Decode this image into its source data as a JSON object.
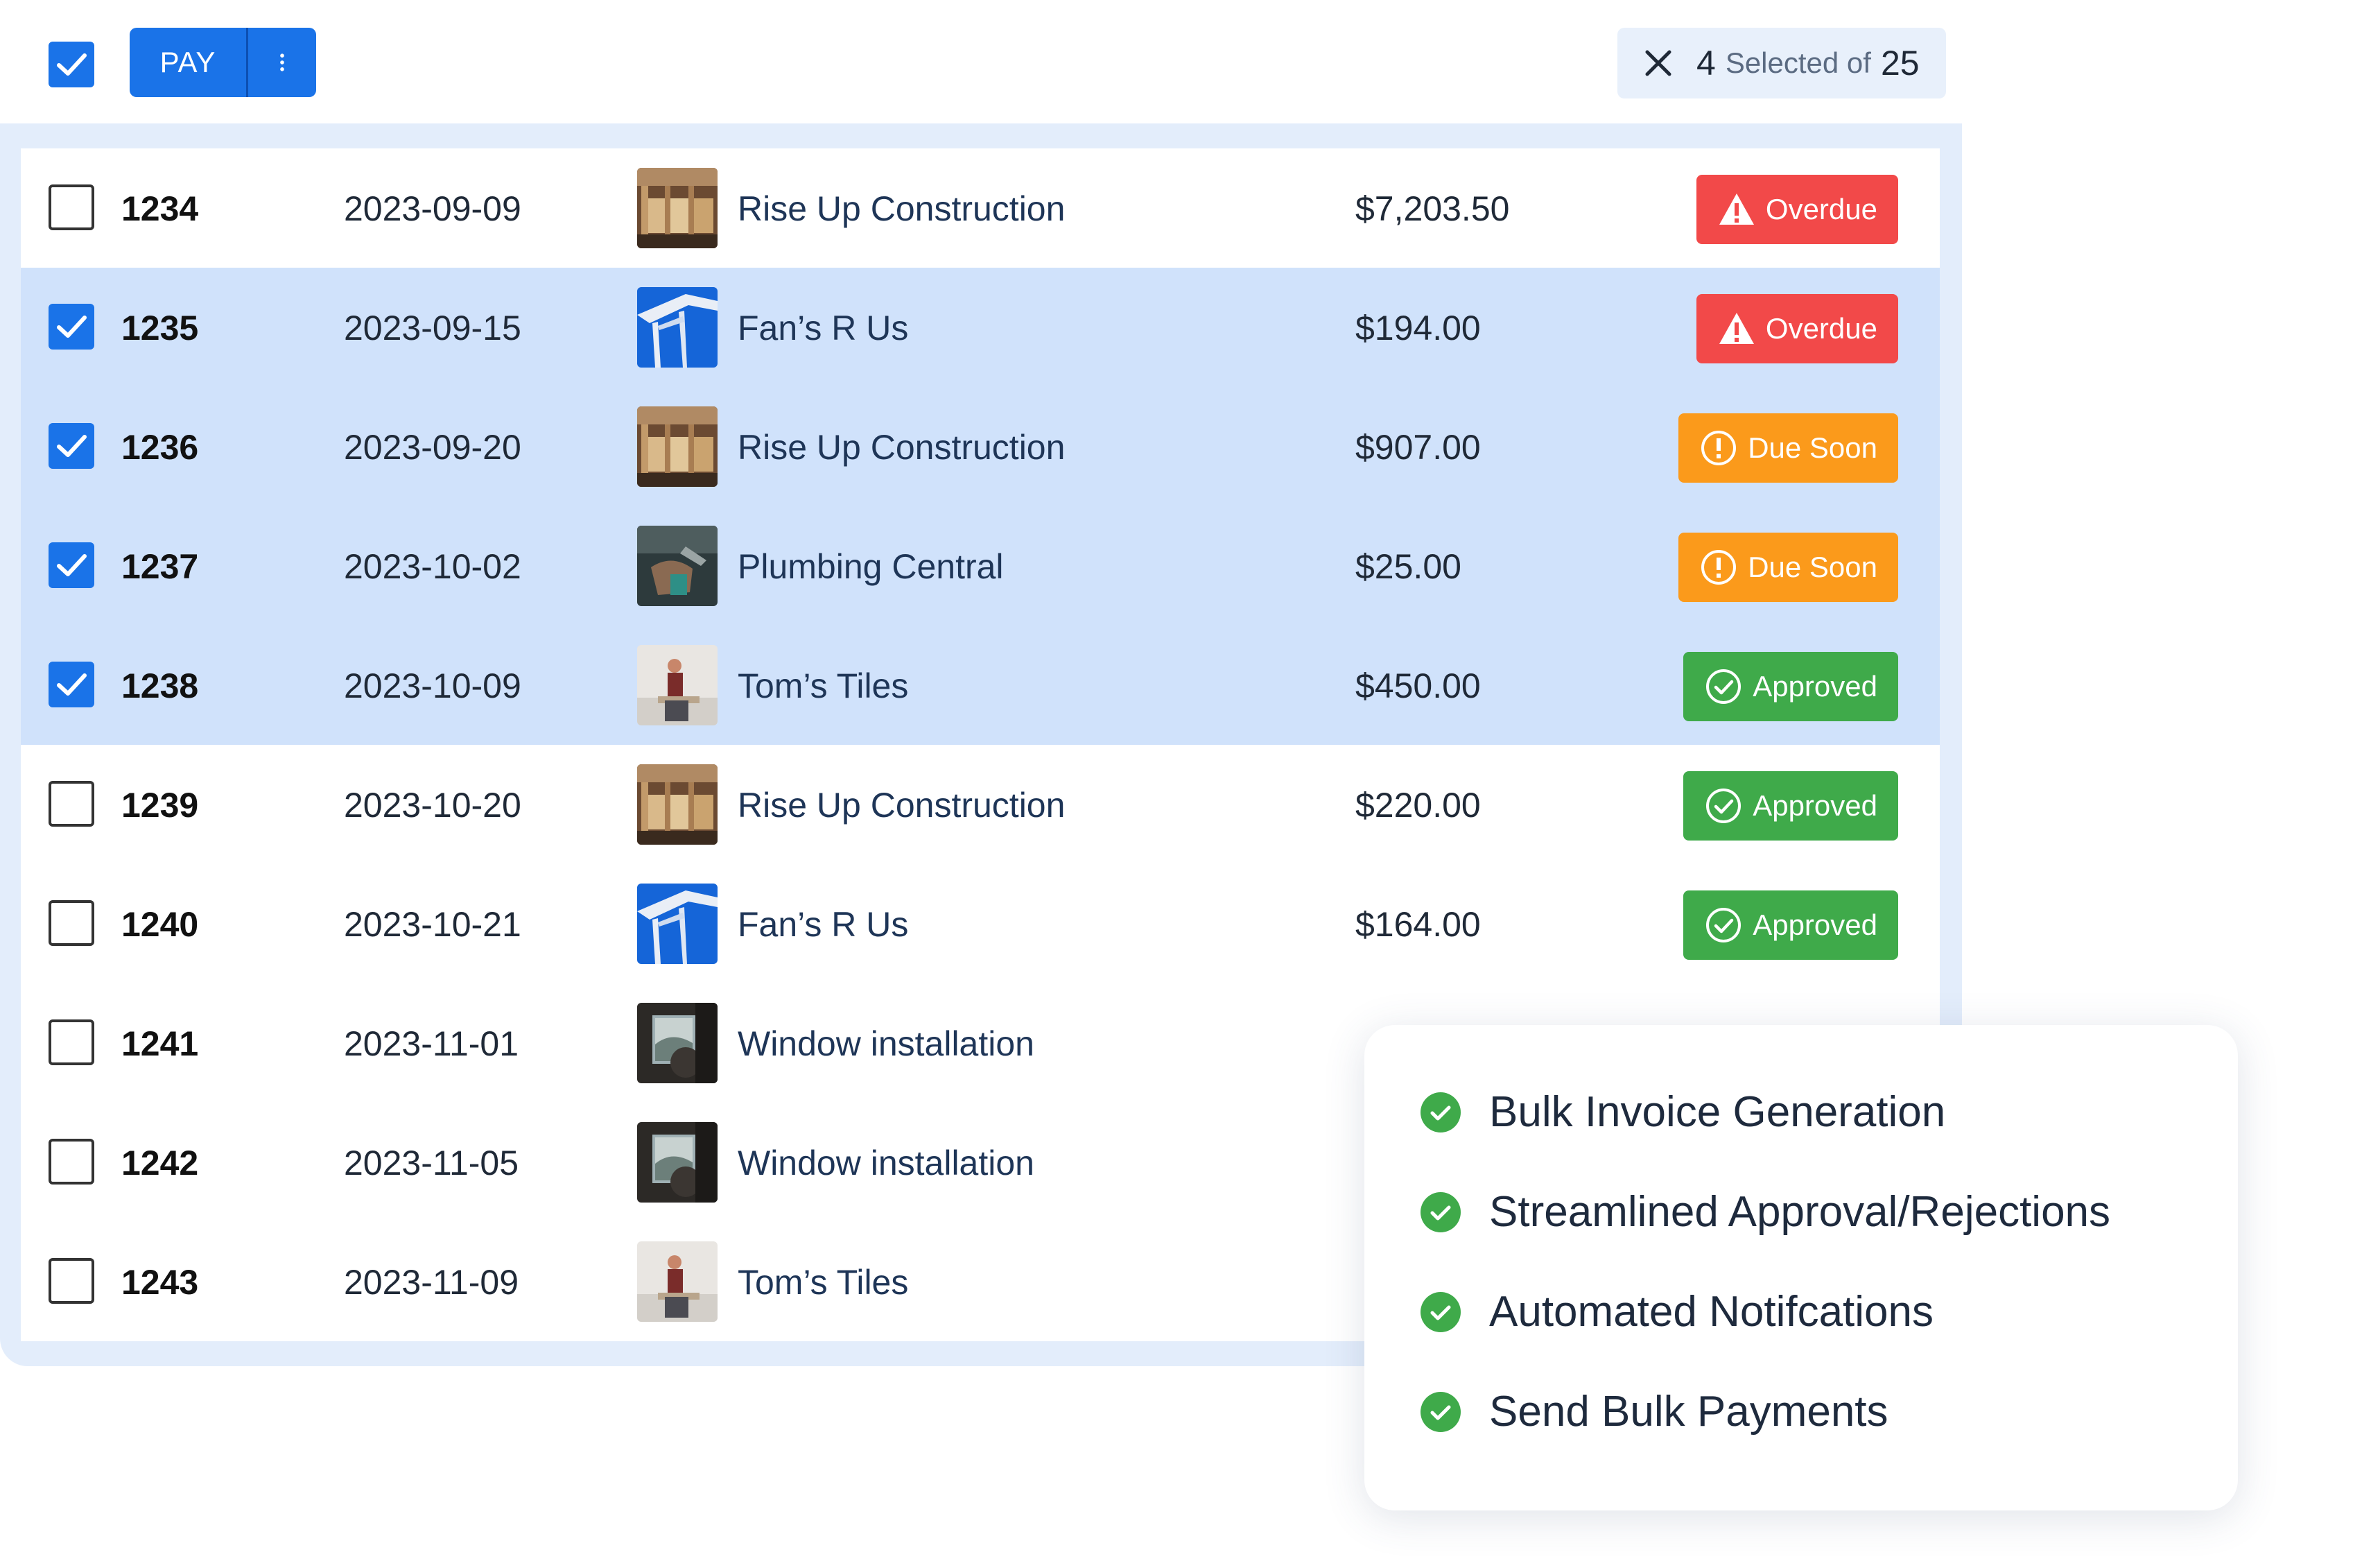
{
  "toolbar": {
    "pay_label": "PAY",
    "selection": {
      "count": "4",
      "middle": "Selected of",
      "total": "25"
    }
  },
  "colors": {
    "primary": "#1a73e8",
    "selected_row": "#d0e2fb",
    "overdue": "#f24949",
    "due_soon": "#fb9a1b",
    "approved": "#3faa4a"
  },
  "invoices": [
    {
      "id": "1234",
      "date": "2023-09-09",
      "vendor": "Rise Up Construction",
      "vendor_icon": "construction-photo",
      "amount": "$7,203.50",
      "status": "Overdue",
      "selected": false
    },
    {
      "id": "1235",
      "date": "2023-09-15",
      "vendor": "Fan’s R Us",
      "vendor_icon": "fan-photo",
      "amount": "$194.00",
      "status": "Overdue",
      "selected": true
    },
    {
      "id": "1236",
      "date": "2023-09-20",
      "vendor": "Rise Up Construction",
      "vendor_icon": "construction-photo",
      "amount": "$907.00",
      "status": "Due Soon",
      "selected": true
    },
    {
      "id": "1237",
      "date": "2023-10-02",
      "vendor": "Plumbing Central",
      "vendor_icon": "plumbing-photo",
      "amount": "$25.00",
      "status": "Due Soon",
      "selected": true
    },
    {
      "id": "1238",
      "date": "2023-10-09",
      "vendor": "Tom’s Tiles",
      "vendor_icon": "tiles-photo",
      "amount": "$450.00",
      "status": "Approved",
      "selected": true
    },
    {
      "id": "1239",
      "date": "2023-10-20",
      "vendor": "Rise Up Construction",
      "vendor_icon": "construction-photo",
      "amount": "$220.00",
      "status": "Approved",
      "selected": false
    },
    {
      "id": "1240",
      "date": "2023-10-21",
      "vendor": "Fan’s R Us",
      "vendor_icon": "fan-photo",
      "amount": "$164.00",
      "status": "Approved",
      "selected": false
    },
    {
      "id": "1241",
      "date": "2023-11-01",
      "vendor": "Window installation",
      "vendor_icon": "window-photo",
      "amount": "",
      "status": "",
      "selected": false
    },
    {
      "id": "1242",
      "date": "2023-11-05",
      "vendor": "Window installation",
      "vendor_icon": "window-photo",
      "amount": "",
      "status": "",
      "selected": false
    },
    {
      "id": "1243",
      "date": "2023-11-09",
      "vendor": "Tom’s Tiles",
      "vendor_icon": "tiles-photo",
      "amount": "",
      "status": "",
      "selected": false
    }
  ],
  "features": [
    "Bulk Invoice Generation",
    "Streamlined Approval/Rejections",
    "Automated Notifcations",
    "Send Bulk Payments"
  ]
}
